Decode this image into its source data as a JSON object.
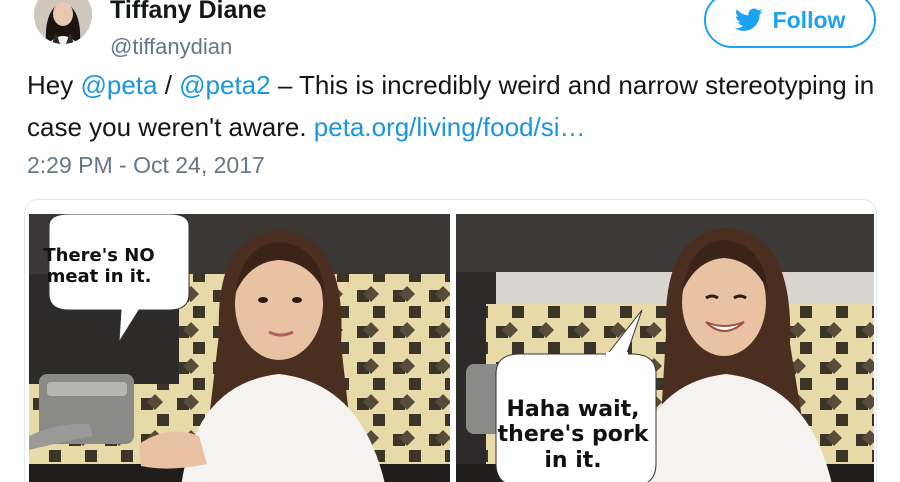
{
  "user": {
    "display_name": "Tiffany Diane",
    "handle": "@tiffanydian",
    "avatar_icon": "profile-photo"
  },
  "follow_button": {
    "label": "Follow",
    "icon": "twitter-bird-icon",
    "color": "#1da1f2"
  },
  "tweet": {
    "text_1": "Hey ",
    "mention_1": "@peta",
    "text_2": " / ",
    "mention_2": "@peta2",
    "text_3": " – This is incredibly weird and narrow stereotyping in case you weren't aware. ",
    "link": "peta.org/living/food/si…",
    "timestamp": "2:29 PM - Oct 24, 2017",
    "link_color": "#1b95e0"
  },
  "media": {
    "left_caption": "There's NO meat in it.",
    "right_caption": "Haha wait, there's pork in it."
  }
}
